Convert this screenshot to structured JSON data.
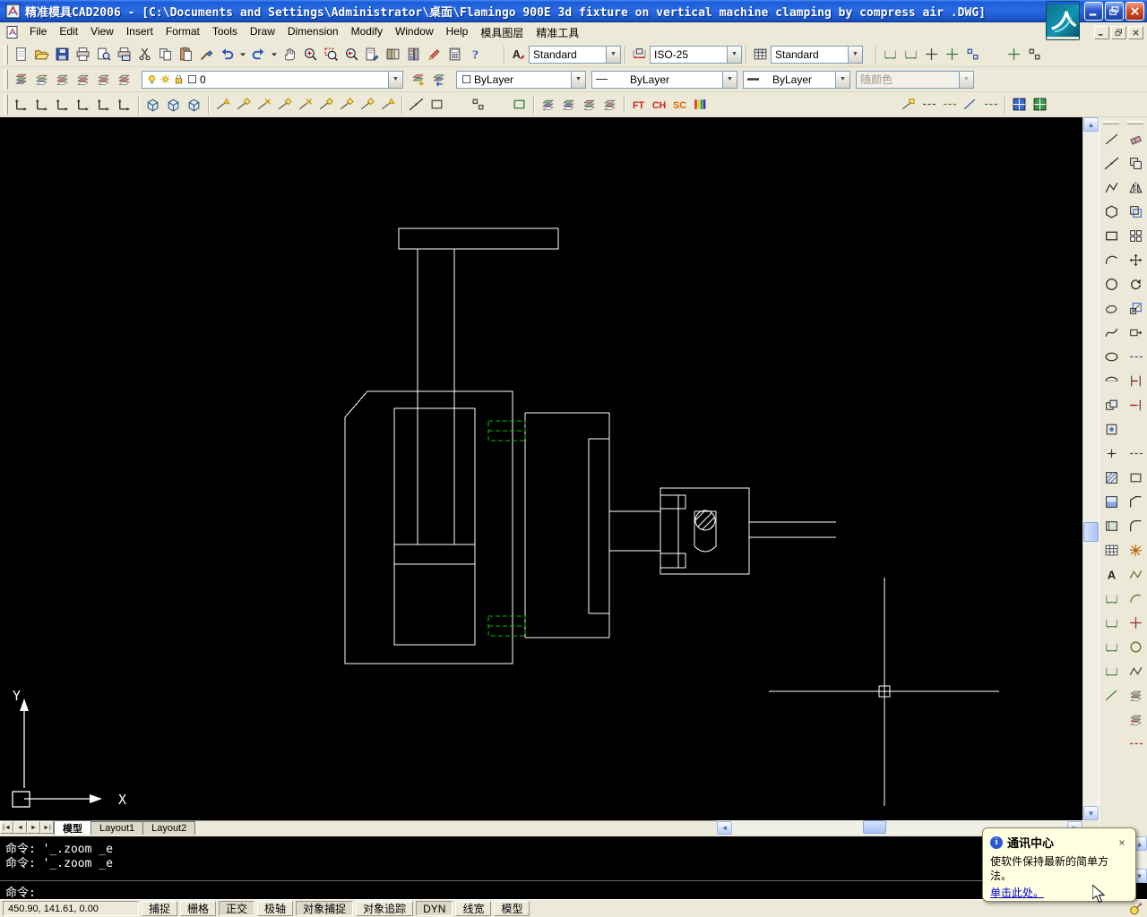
{
  "window": {
    "title": "精准模具CAD2006 - [C:\\Documents and Settings\\Administrator\\桌面\\Flamingo 900E 3d fixture on vertical machine clamping by compress air .DWG]",
    "buttons": {
      "minimize": "minimize",
      "restore": "restore",
      "close": "close"
    }
  },
  "menu": {
    "items": [
      "File",
      "Edit",
      "View",
      "Insert",
      "Format",
      "Tools",
      "Draw",
      "Dimension",
      "Modify",
      "Window",
      "Help",
      "模具图层",
      "精准工具"
    ]
  },
  "toolbar_standard": {
    "icons": [
      "new-icon",
      "open-icon",
      "save-icon",
      "print-icon",
      "print-preview-icon",
      "publish-icon",
      "cut-icon",
      "copy-icon",
      "paste-icon",
      "match-properties-icon",
      "undo-icon",
      "undo-dropdown-icon",
      "redo-icon",
      "redo-dropdown-icon",
      "pan-icon",
      "zoom-realtime-icon",
      "zoom-window-icon",
      "zoom-previous-icon",
      "properties-icon",
      "designcenter-icon",
      "tool-palettes-icon",
      "markup-icon",
      "calculator-icon",
      "help-icon"
    ]
  },
  "toolbar_styles": {
    "text_style": {
      "icon": "text-style-icon",
      "value": "Standard"
    },
    "dim_style": {
      "icon": "dim-style-icon",
      "value": "ISO-25"
    },
    "table_style": {
      "icon": "table-style-icon",
      "value": "Standard"
    },
    "right_icons": [
      "dim-edit-icon",
      "dim-update-icon",
      "distance-icon",
      "area-icon",
      "list-icon",
      "locate-point-icon",
      "markup-set-icon",
      "options-icon"
    ]
  },
  "toolbar_layers": {
    "icons": [
      "layer-properties-icon",
      "layer-states-icon",
      "layer-isolate-icon",
      "layer-off-icon",
      "layer-freeze-icon",
      "layer-lock-icon"
    ],
    "layer_combo": {
      "on_icon": "bulb-icon",
      "freeze_icon": "sun-icon",
      "lock_icon": "lock-icon",
      "color_icon": "swatch-icon",
      "value": "0"
    },
    "after_icons": [
      "make-layer-current-icon",
      "layer-previous-icon"
    ],
    "color_combo": {
      "icon": "swatch-icon",
      "value": "ByLayer"
    },
    "linetype_combo": {
      "icon": "linetype-sample-icon",
      "value": "ByLayer"
    },
    "lineweight_combo": {
      "icon": "lineweight-sample-icon",
      "value": "ByLayer"
    },
    "plotstyle_combo": {
      "value": "随颜色"
    }
  },
  "toolbar_tools": {
    "ucs_icons": [
      "ucs-icon",
      "ucs-world-icon",
      "ucs-previous-icon",
      "ucs-face-icon",
      "ucs-object-icon",
      "ucs-origin-icon"
    ],
    "view_icons": [
      "named-views-icon",
      "view-top-icon",
      "view-3d-icon"
    ],
    "snap_icons": [
      "snap-endpoint-icon",
      "snap-midpoint-icon",
      "snap-intersection-icon",
      "snap-center-icon",
      "snap-quadrant-icon",
      "snap-tangent-icon",
      "snap-perpendicular-icon",
      "snap-node-icon",
      "snap-nearest-icon"
    ],
    "draw_order_icons": [
      "construction-line-icon",
      "ray-icon",
      "divide-icon",
      "measure-icon",
      "point-style-icon",
      "draworder-icon"
    ],
    "layer2_icons": [
      "layer-walk-icon",
      "layer-match-icon",
      "layer-merge-icon",
      "layer-delete-icon"
    ],
    "text_icons": [
      "ft-icon",
      "dim-ch-icon",
      "dim-sc-icon"
    ],
    "color_icons": [
      "color-bars-icon",
      "linetype-manager-icon"
    ],
    "right_icons": [
      "point-marker-icon",
      "snap-target-icon",
      "osnap-settings-icon",
      "tracking-icon",
      "ortho-mode-icon",
      "dyn-mode-icon"
    ],
    "far_right_icons": [
      "blue-grid-icon",
      "green-grid-icon"
    ]
  },
  "dock": {
    "draw_icons": [
      "line-icon",
      "construction-line-icon",
      "polyline-icon",
      "polygon-icon",
      "rectangle-icon",
      "arc-icon",
      "circle-icon",
      "revcloud-icon",
      "spline-icon",
      "ellipse-icon",
      "ellipse-arc-icon",
      "insert-block-icon",
      "make-block-icon",
      "point-icon",
      "hatch-icon",
      "gradient-icon",
      "region-icon",
      "table-icon",
      "mtext-icon",
      "dim-linear-icon",
      "dim-aligned-icon",
      "dim-radius-icon",
      "dim-angular-icon",
      "quick-dim-icon"
    ],
    "modify_icons": [
      "erase-icon",
      "copy-object-icon",
      "mirror-icon",
      "offset-icon",
      "array-icon",
      "move-icon",
      "rotate-icon",
      "scale-icon",
      "stretch-icon",
      "lengthen-icon",
      "trim-icon",
      "extend-icon",
      "break-at-point-icon",
      "break-icon",
      "join-icon",
      "chamfer-icon",
      "fillet-icon",
      "explode-icon",
      "edit-polyline-icon",
      "edit-spline-icon",
      "edit-hatch-icon",
      "match-layer-icon",
      "color-control-icon",
      "layer-off2-icon",
      "layer-lock2-icon",
      "properties2-icon"
    ]
  },
  "canvas": {
    "ucs_x_label": "X",
    "ucs_y_label": "Y"
  },
  "tabs": {
    "items": [
      {
        "label": "模型",
        "active": true
      },
      {
        "label": "Layout1",
        "active": false
      },
      {
        "label": "Layout2",
        "active": false
      }
    ]
  },
  "command": {
    "history": [
      "命令: '_.zoom _e",
      "命令: '_.zoom _e"
    ],
    "prompt": "命令:"
  },
  "status": {
    "coords": "450.90, 141.61, 0.00",
    "toggles": [
      {
        "label": "捕捉",
        "on": false
      },
      {
        "label": "栅格",
        "on": false
      },
      {
        "label": "正交",
        "on": true
      },
      {
        "label": "极轴",
        "on": false
      },
      {
        "label": "对象捕捉",
        "on": true
      },
      {
        "label": "对象追踪",
        "on": false
      },
      {
        "label": "DYN",
        "on": true
      },
      {
        "label": "线宽",
        "on": false
      },
      {
        "label": "模型",
        "on": false
      }
    ]
  },
  "popup": {
    "title": "通讯中心",
    "body": "使软件保持最新的简单方法。",
    "link": "单击此处。",
    "close_glyph": "×"
  }
}
